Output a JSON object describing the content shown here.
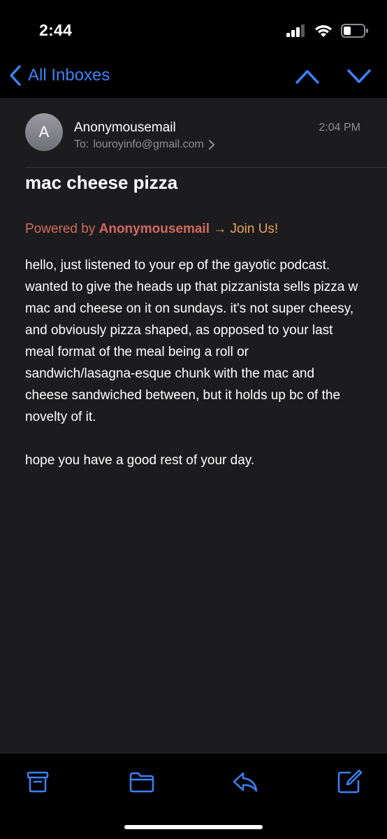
{
  "status_bar": {
    "time": "2:44"
  },
  "nav": {
    "back_label": "All Inboxes",
    "accent_color": "#3b82f6"
  },
  "message": {
    "avatar_initial": "A",
    "sender": "Anonymousemail",
    "to_label": "To:",
    "to_address": "louroyinfo@gmail.com",
    "time": "2:04 PM",
    "subject": "mac cheese pizza",
    "powered_prefix": "Powered by",
    "powered_brand": "Anonymousemail",
    "powered_join": "→ Join Us!",
    "body_paragraphs": [
      "hello, just listened to your ep of the gayotic podcast. wanted to give the heads up that pizzanista sells pizza w mac and cheese on it on sundays. it's not super cheesy, and obviously pizza shaped, as opposed to your last meal format of the meal being a roll or sandwich/lasagna-esque chunk with the mac and cheese sandwiched between, but it holds up bc of the novelty of it.",
      "hope you have a good rest of your day."
    ]
  },
  "toolbar": {
    "icons": [
      "archive-icon",
      "folder-icon",
      "reply-icon",
      "compose-icon"
    ]
  }
}
